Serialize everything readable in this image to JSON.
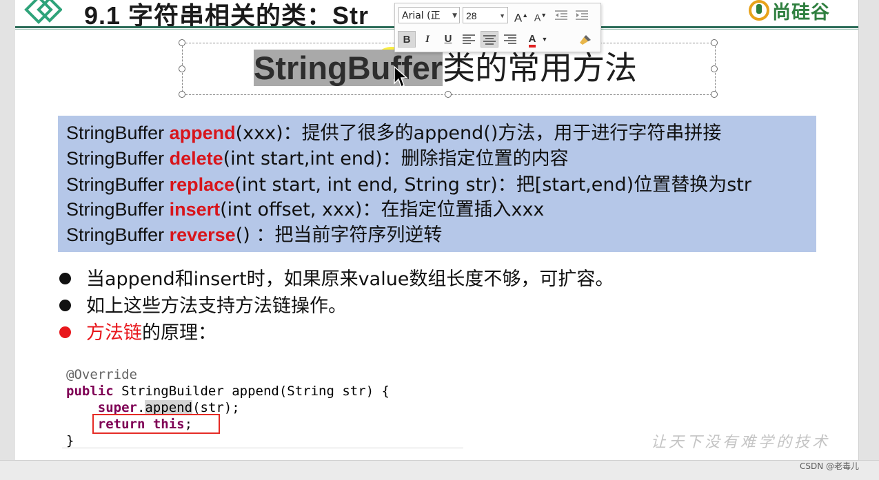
{
  "header": {
    "title": "9.1 字符串相关的类：Str",
    "brand": "尚硅谷"
  },
  "toolbar": {
    "font_name": "Arial (正",
    "font_size": "28",
    "buttons": {
      "grow_font": "A",
      "shrink_font": "A",
      "bold": "B",
      "italic": "I",
      "underline": "U",
      "font_color": "A"
    },
    "font_color_hex": "#e02020"
  },
  "slide_title": {
    "selected_text": "StringBuffer",
    "rest_text": "类的常用方法"
  },
  "methods": [
    {
      "prefix": "StringBuffer ",
      "name": "append",
      "suffix": "(xxx)：提供了很多的append()方法，用于进行字符串拼接"
    },
    {
      "prefix": "StringBuffer ",
      "name": "delete",
      "suffix": "(int start,int end)：删除指定位置的内容"
    },
    {
      "prefix": "StringBuffer ",
      "name": "replace",
      "suffix": "(int start, int end, String str)：把[start,end)位置替换为str"
    },
    {
      "prefix": "StringBuffer ",
      "name": "insert",
      "suffix": "(int offset, xxx)：在指定位置插入xxx"
    },
    {
      "prefix": "StringBuffer ",
      "name": "reverse",
      "suffix": "() ：把当前字符序列逆转"
    }
  ],
  "bullets": [
    {
      "text": "当append和insert时，如果原来value数组长度不够，可扩容。"
    },
    {
      "text": "如上这些方法支持方法链操作。"
    },
    {
      "highlight": "方法链",
      "text": "的原理："
    }
  ],
  "code": {
    "annotation": "@Override",
    "line2_kw": "public",
    "line2_rest": " StringBuilder append(String str) {",
    "line3_kw": "super",
    "line3_mid": ".",
    "line3_hl": "append",
    "line3_rest": "(str);",
    "line4_kw": "return this",
    "line4_rest": ";",
    "line5": "}"
  },
  "watermark": "让天下没有难学的技术",
  "footer_credit": "CSDN @老毒儿",
  "colors": {
    "method_box": "#b5c7e8",
    "keyword_red": "#d8151b",
    "header_line": "#2a6b57",
    "code_keyword": "#7f0055"
  }
}
